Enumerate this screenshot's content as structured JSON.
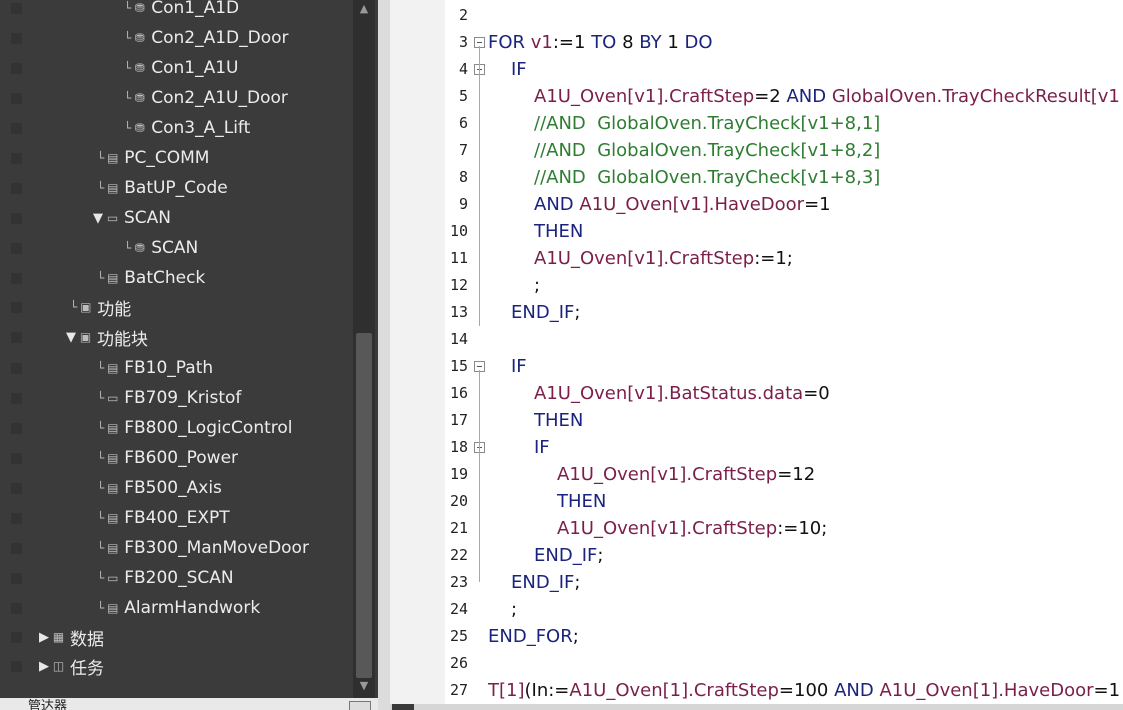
{
  "tree": {
    "items": [
      {
        "label": "Con1_A1D",
        "icon": "connection-icon",
        "conn": "└",
        "arrow": ""
      },
      {
        "label": "Con2_A1D_Door",
        "icon": "connection-icon",
        "conn": "└",
        "arrow": ""
      },
      {
        "label": "Con1_A1U",
        "icon": "connection-icon",
        "conn": "└",
        "arrow": ""
      },
      {
        "label": "Con2_A1U_Door",
        "icon": "connection-icon",
        "conn": "└",
        "arrow": ""
      },
      {
        "label": "Con3_A_Lift",
        "icon": "connection-icon",
        "conn": "└",
        "arrow": ""
      },
      {
        "label": "PC_COMM",
        "icon": "program-icon",
        "conn": "└",
        "arrow": ""
      },
      {
        "label": "BatUP_Code",
        "icon": "program-icon",
        "conn": "└",
        "arrow": ""
      },
      {
        "label": "SCAN",
        "icon": "function-block-icon",
        "conn": "",
        "arrow": "▼"
      },
      {
        "label": "SCAN",
        "icon": "connection-icon",
        "conn": "└",
        "arrow": ""
      },
      {
        "label": "BatCheck",
        "icon": "program-icon",
        "conn": "└",
        "arrow": ""
      },
      {
        "label": "功能",
        "icon": "folder-icon",
        "conn": "└",
        "arrow": ""
      },
      {
        "label": "功能块",
        "icon": "folder-icon",
        "conn": "",
        "arrow": "▼"
      },
      {
        "label": "FB10_Path",
        "icon": "program-icon",
        "conn": "└",
        "arrow": ""
      },
      {
        "label": "FB709_Kristof",
        "icon": "function-block-icon",
        "conn": "└",
        "arrow": ""
      },
      {
        "label": "FB800_LogicControl",
        "icon": "program-icon",
        "conn": "└",
        "arrow": ""
      },
      {
        "label": "FB600_Power",
        "icon": "program-icon",
        "conn": "└",
        "arrow": ""
      },
      {
        "label": "FB500_Axis",
        "icon": "program-icon",
        "conn": "└",
        "arrow": ""
      },
      {
        "label": "FB400_EXPT",
        "icon": "program-icon",
        "conn": "└",
        "arrow": ""
      },
      {
        "label": "FB300_ManMoveDoor",
        "icon": "program-icon",
        "conn": "└",
        "arrow": ""
      },
      {
        "label": "FB200_SCAN",
        "icon": "function-block-icon",
        "conn": "└",
        "arrow": ""
      },
      {
        "label": "AlarmHandwork",
        "icon": "program-icon",
        "conn": "└",
        "arrow": ""
      },
      {
        "label": "数据",
        "icon": "table-icon",
        "conn": "",
        "arrow": "▶"
      },
      {
        "label": "任务",
        "icon": "task-icon",
        "conn": "",
        "arrow": "▶"
      }
    ],
    "bottom_panel_label": "管达器"
  },
  "editor": {
    "lines": [
      {
        "n": "2",
        "indent": 0,
        "tokens": []
      },
      {
        "n": "3",
        "indent": 0,
        "tokens": [
          [
            "kw",
            "FOR "
          ],
          [
            "v",
            "v1"
          ],
          [
            "n",
            ":=1 "
          ],
          [
            "kw",
            "TO "
          ],
          [
            "n",
            "8 "
          ],
          [
            "kw",
            "BY "
          ],
          [
            "n",
            "1 "
          ],
          [
            "kw",
            "DO"
          ]
        ]
      },
      {
        "n": "4",
        "indent": 1,
        "tokens": [
          [
            "kw",
            "IF"
          ]
        ]
      },
      {
        "n": "5",
        "indent": 2,
        "tokens": [
          [
            "v",
            "A1U_Oven[v1].CraftStep"
          ],
          [
            "n",
            "=2 "
          ],
          [
            "kw",
            "AND "
          ],
          [
            "v",
            "GlobalOven.TrayCheckResult[v1"
          ]
        ]
      },
      {
        "n": "6",
        "indent": 2,
        "tokens": [
          [
            "cm",
            "//AND  GlobalOven.TrayCheck[v1+8,1]"
          ]
        ]
      },
      {
        "n": "7",
        "indent": 2,
        "tokens": [
          [
            "cm",
            "//AND  GlobalOven.TrayCheck[v1+8,2]"
          ]
        ]
      },
      {
        "n": "8",
        "indent": 2,
        "tokens": [
          [
            "cm",
            "//AND  GlobalOven.TrayCheck[v1+8,3]"
          ]
        ]
      },
      {
        "n": "9",
        "indent": 2,
        "tokens": [
          [
            "kw",
            "AND "
          ],
          [
            "v",
            "A1U_Oven[v1].HaveDoor"
          ],
          [
            "n",
            "=1"
          ]
        ]
      },
      {
        "n": "10",
        "indent": 2,
        "tokens": [
          [
            "kw",
            "THEN"
          ]
        ]
      },
      {
        "n": "11",
        "indent": 2,
        "tokens": [
          [
            "v",
            "A1U_Oven[v1].CraftStep"
          ],
          [
            "n",
            ":=1;"
          ]
        ]
      },
      {
        "n": "12",
        "indent": 2,
        "tokens": [
          [
            "n",
            ";"
          ]
        ]
      },
      {
        "n": "13",
        "indent": 1,
        "tokens": [
          [
            "kw",
            "END_IF"
          ],
          [
            "n",
            ";"
          ]
        ]
      },
      {
        "n": "14",
        "indent": 0,
        "tokens": []
      },
      {
        "n": "15",
        "indent": 1,
        "tokens": [
          [
            "kw",
            "IF"
          ]
        ]
      },
      {
        "n": "16",
        "indent": 2,
        "tokens": [
          [
            "v",
            "A1U_Oven[v1].BatStatus.data"
          ],
          [
            "n",
            "=0"
          ]
        ]
      },
      {
        "n": "17",
        "indent": 2,
        "tokens": [
          [
            "kw",
            "THEN"
          ]
        ]
      },
      {
        "n": "18",
        "indent": 2,
        "tokens": [
          [
            "kw",
            "IF"
          ]
        ]
      },
      {
        "n": "19",
        "indent": 3,
        "tokens": [
          [
            "v",
            "A1U_Oven[v1].CraftStep"
          ],
          [
            "n",
            "=12"
          ]
        ]
      },
      {
        "n": "20",
        "indent": 3,
        "tokens": [
          [
            "kw",
            "THEN"
          ]
        ]
      },
      {
        "n": "21",
        "indent": 3,
        "tokens": [
          [
            "v",
            "A1U_Oven[v1].CraftStep"
          ],
          [
            "n",
            ":=10;"
          ]
        ]
      },
      {
        "n": "22",
        "indent": 2,
        "tokens": [
          [
            "kw",
            "END_IF"
          ],
          [
            "n",
            ";"
          ]
        ]
      },
      {
        "n": "23",
        "indent": 1,
        "tokens": [
          [
            "kw",
            "END_IF"
          ],
          [
            "n",
            ";"
          ]
        ]
      },
      {
        "n": "24",
        "indent": 1,
        "tokens": [
          [
            "n",
            ";"
          ]
        ]
      },
      {
        "n": "25",
        "indent": 0,
        "tokens": [
          [
            "kw",
            "END_FOR"
          ],
          [
            "n",
            ";"
          ]
        ]
      },
      {
        "n": "26",
        "indent": 0,
        "tokens": []
      },
      {
        "n": "27",
        "indent": 0,
        "tokens": [
          [
            "v",
            "T[1]"
          ],
          [
            "n",
            "(In:="
          ],
          [
            "v",
            "A1U_Oven[1].CraftStep"
          ],
          [
            "n",
            "=100 "
          ],
          [
            "kw",
            "AND "
          ],
          [
            "v",
            "A1U_Oven[1].HaveDoor"
          ],
          [
            "n",
            "=1"
          ]
        ]
      }
    ]
  },
  "colors": {
    "tree_bg": "#3b3b3b",
    "keyword": "#1a237e",
    "variable": "#7b1f4a",
    "comment": "#2e7d32"
  }
}
